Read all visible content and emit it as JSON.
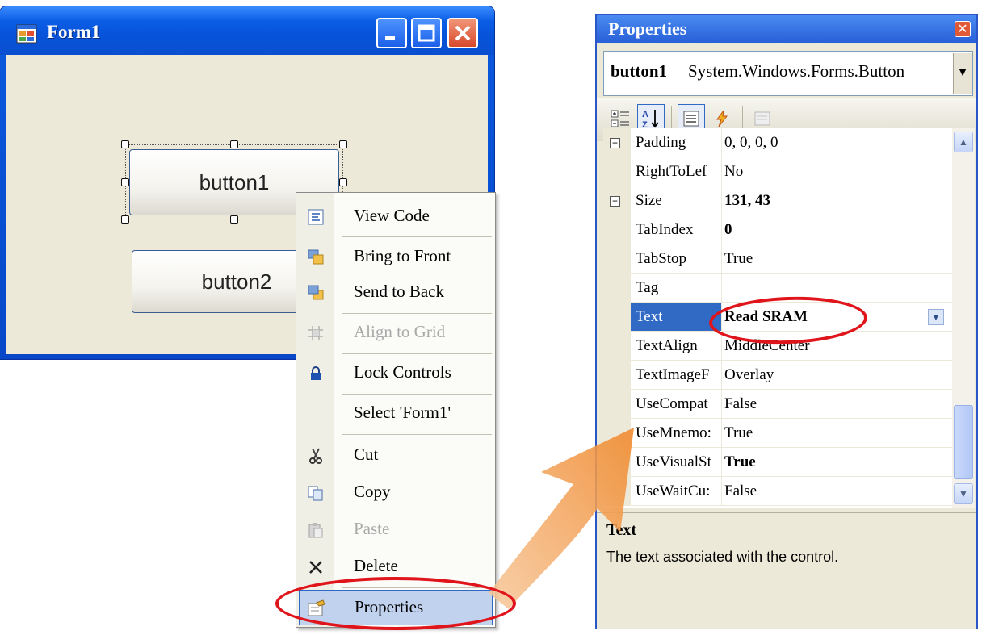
{
  "form": {
    "title": "Form1",
    "app_icon": "form-app-icon",
    "button1_label": "button1",
    "button2_label": "button2"
  },
  "context_menu": {
    "items": [
      {
        "label": "View Code",
        "icon": "view-code-icon",
        "enabled": true
      },
      {
        "label": "Bring to Front",
        "icon": "bring-to-front-icon",
        "enabled": true
      },
      {
        "label": "Send to Back",
        "icon": "send-to-back-icon",
        "enabled": true
      },
      {
        "label": "Align to Grid",
        "icon": "align-to-grid-icon",
        "enabled": false
      },
      {
        "label": "Lock Controls",
        "icon": "lock-icon",
        "enabled": true
      },
      {
        "label": "Select 'Form1'",
        "icon": "",
        "enabled": true
      },
      {
        "label": "Cut",
        "icon": "scissors-icon",
        "enabled": true
      },
      {
        "label": "Copy",
        "icon": "copy-icon",
        "enabled": true
      },
      {
        "label": "Paste",
        "icon": "paste-icon",
        "enabled": false
      },
      {
        "label": "Delete",
        "icon": "delete-icon",
        "enabled": true
      },
      {
        "label": "Properties",
        "icon": "properties-icon",
        "enabled": true,
        "highlighted": true
      }
    ]
  },
  "properties": {
    "title": "Properties",
    "object_name": "button1",
    "object_type": "System.Windows.Forms.Button",
    "rows": [
      {
        "name": "Padding",
        "value": "0, 0, 0, 0",
        "expandable": true,
        "bold": false
      },
      {
        "name": "RightToLef",
        "value": "No",
        "expandable": false,
        "bold": false
      },
      {
        "name": "Size",
        "value": "131, 43",
        "expandable": true,
        "bold": true
      },
      {
        "name": "TabIndex",
        "value": "0",
        "expandable": false,
        "bold": true
      },
      {
        "name": "TabStop",
        "value": "True",
        "expandable": false,
        "bold": false
      },
      {
        "name": "Tag",
        "value": "",
        "expandable": false,
        "bold": false
      },
      {
        "name": "Text",
        "value": "Read SRAM",
        "expandable": false,
        "bold": true,
        "selected": true
      },
      {
        "name": "TextAlign",
        "value": "MiddleCenter",
        "expandable": false,
        "bold": false
      },
      {
        "name": "TextImageF",
        "value": "Overlay",
        "expandable": false,
        "bold": false
      },
      {
        "name": "UseCompat",
        "value": "False",
        "expandable": false,
        "bold": false
      },
      {
        "name": "UseMnemo:",
        "value": "True",
        "expandable": false,
        "bold": false
      },
      {
        "name": "UseVisualSt",
        "value": "True",
        "expandable": false,
        "bold": true
      },
      {
        "name": "UseWaitCu:",
        "value": "False",
        "expandable": false,
        "bold": false
      }
    ],
    "description": {
      "title": "Text",
      "text": "The text associated with the control."
    }
  },
  "colors": {
    "xp_blue": "#0753d9",
    "selection": "#316ac5",
    "annotation_red": "#e0151b",
    "arrow_orange": "#f5a15a"
  }
}
